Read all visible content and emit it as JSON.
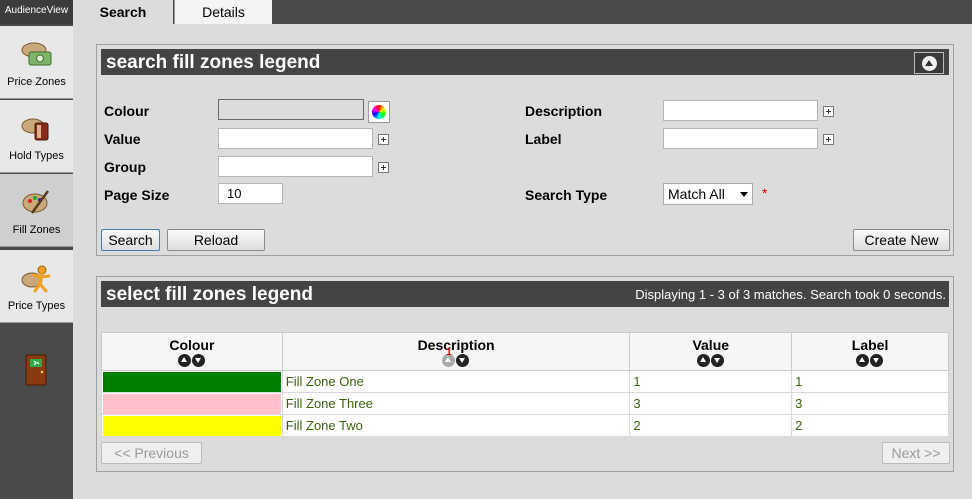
{
  "app": {
    "title": "AudienceView"
  },
  "sidebar": {
    "items": [
      {
        "label": "Price Zones",
        "icon": "price-zones-icon"
      },
      {
        "label": "Hold Types",
        "icon": "hold-types-icon"
      },
      {
        "label": "Fill Zones",
        "icon": "fill-zones-icon"
      },
      {
        "label": "Price Types",
        "icon": "price-types-icon"
      }
    ],
    "exit_icon": "exit-door-icon"
  },
  "tabs": [
    {
      "label": "Search",
      "active": true
    },
    {
      "label": "Details",
      "active": false
    }
  ],
  "search": {
    "title": "search fill zones legend",
    "fields": {
      "colour": {
        "label": "Colour",
        "value": ""
      },
      "value": {
        "label": "Value",
        "value": ""
      },
      "group": {
        "label": "Group",
        "value": ""
      },
      "page_size": {
        "label": "Page Size",
        "value": "10"
      },
      "description": {
        "label": "Description",
        "value": ""
      },
      "label": {
        "label": "Label",
        "value": ""
      },
      "search_type": {
        "label": "Search Type",
        "value": "Match All",
        "required_mark": "*"
      }
    },
    "buttons": {
      "search": "Search",
      "reload": "Reload",
      "create_new": "Create New"
    }
  },
  "results": {
    "title": "select fill zones legend",
    "status": "Displaying 1 - 3 of 3 matches. Search took 0 seconds.",
    "columns": [
      "Colour",
      "Description",
      "Value",
      "Label"
    ],
    "sort_order_marker": "1",
    "rows": [
      {
        "colour": "#008000",
        "description": "Fill Zone One",
        "value": "1",
        "label": "1"
      },
      {
        "colour": "#ffc0cb",
        "description": "Fill Zone Three",
        "value": "3",
        "label": "3"
      },
      {
        "colour": "#ffff00",
        "description": "Fill Zone Two",
        "value": "2",
        "label": "2"
      }
    ],
    "pagination": {
      "previous": "<< Previous",
      "next": "Next >>"
    }
  }
}
